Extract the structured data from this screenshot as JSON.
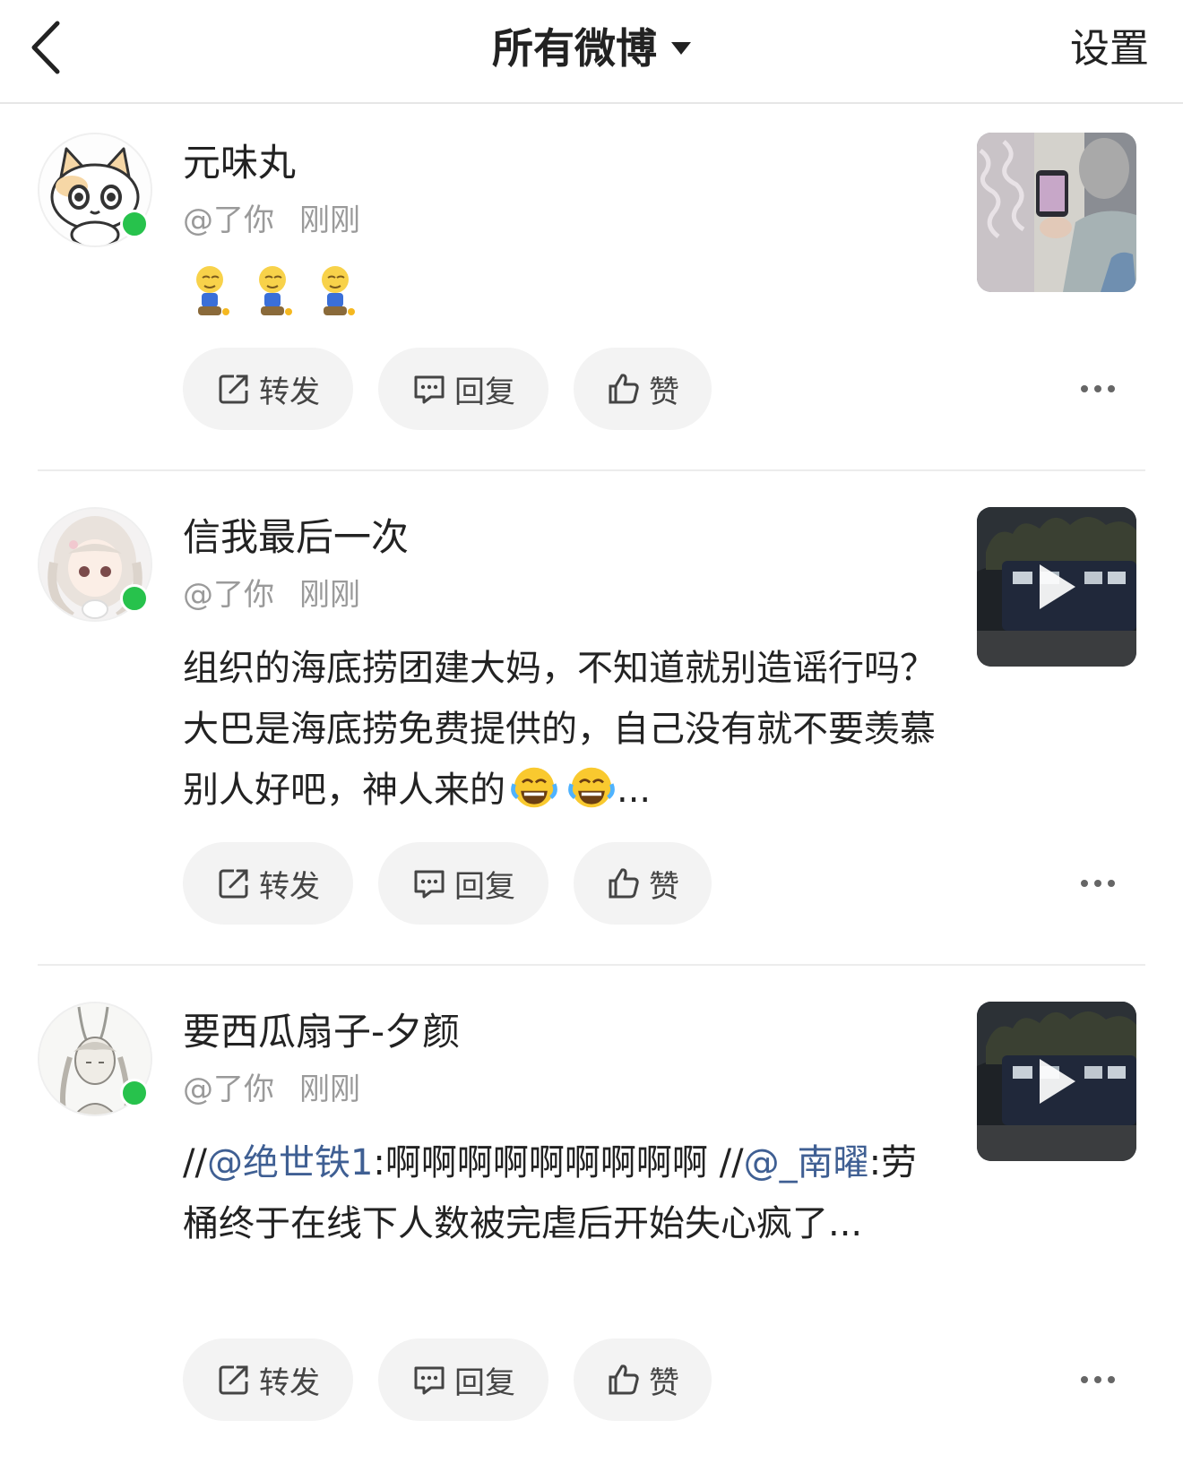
{
  "header": {
    "title": "所有微博",
    "settings_label": "设置"
  },
  "posts": [
    {
      "username": "元味丸",
      "handle": "@了你",
      "time": "刚刚",
      "content": "",
      "emoji_count": 3,
      "thumbnail": "image",
      "actions": {
        "repost": "转发",
        "reply": "回复",
        "like": "赞"
      }
    },
    {
      "username": "信我最后一次",
      "handle": "@了你",
      "time": "刚刚",
      "content": "组织的海底捞团建大妈，不知道就别造谣行吗？大巴是海底捞免费提供的，自己没有就不要羡慕别人好吧，神人来的",
      "content_tail": "...",
      "thumbnail": "video",
      "actions": {
        "repost": "转发",
        "reply": "回复",
        "like": "赞"
      }
    },
    {
      "username": "要西瓜扇子-夕颜",
      "handle": "@了你",
      "time": "刚刚",
      "content_parts": {
        "p1": "//",
        "m1": "@绝世铁1",
        "p2": ":啊啊啊啊啊啊啊啊啊 //",
        "m2": "@_南曜",
        "p3": ":劳桶终于在线下人数被完虐后开始失心疯了..."
      },
      "thumbnail": "video",
      "actions": {
        "repost": "转发",
        "reply": "回复",
        "like": "赞"
      }
    }
  ],
  "colors": {
    "online": "#27c24c",
    "mention": "#3f5f93",
    "button_bg": "#f3f3f3"
  },
  "icons": [
    "back-arrow-icon",
    "dropdown-caret-icon",
    "repost-icon",
    "reply-icon",
    "like-icon",
    "more-icon",
    "play-icon",
    "emoji-icon"
  ]
}
